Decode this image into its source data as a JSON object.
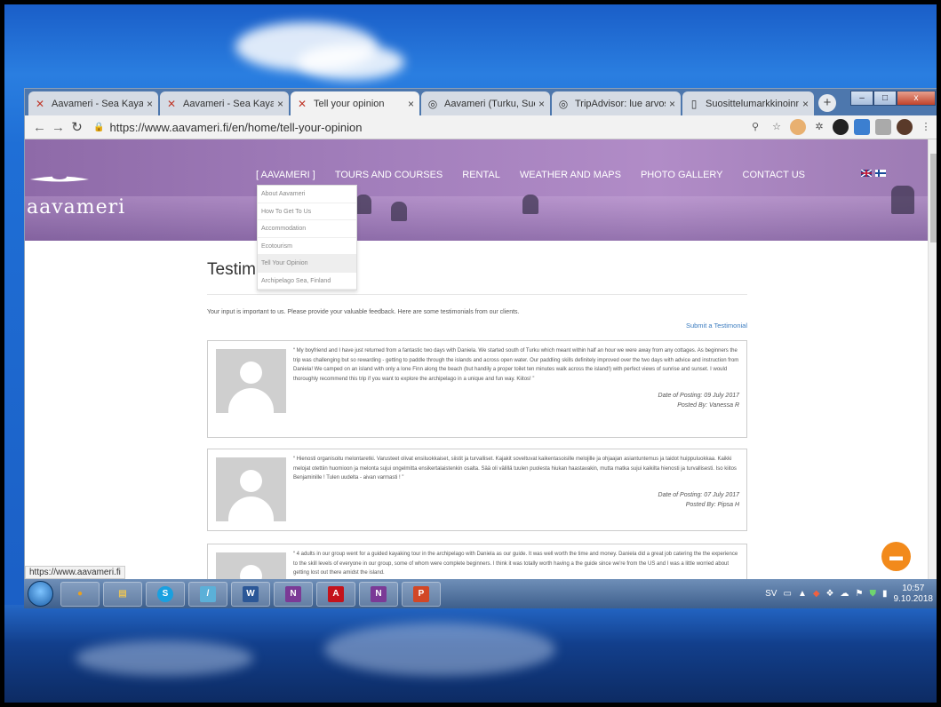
{
  "browser": {
    "tabs": [
      {
        "label": "Aavameri - Sea Kayaking",
        "icon": "aavameri-favicon",
        "active": false
      },
      {
        "label": "Aavameri - Sea Kayaking",
        "icon": "aavameri-favicon",
        "active": false
      },
      {
        "label": "Tell your opinion",
        "icon": "aavameri-favicon",
        "active": true
      },
      {
        "label": "Aavameri (Turku, Suomi)",
        "icon": "tripadvisor-favicon",
        "active": false
      },
      {
        "label": "TripAdvisor: lue arvostel",
        "icon": "tripadvisor-favicon",
        "active": false
      },
      {
        "label": "Suosittelumarkkinoinnin",
        "icon": "document-favicon",
        "active": false
      }
    ],
    "new_tab": "+",
    "close_glyph": "×",
    "window_buttons": {
      "minimize": "–",
      "maximize": "□",
      "close": "x"
    },
    "url": "https://www.aavameri.fi/en/home/tell-your-opinion",
    "status_url": "https://www.aavameri.fi"
  },
  "site": {
    "logo": "aavameri",
    "nav": [
      "[ Aavameri ]",
      "Tours and Courses",
      "Rental",
      "Weather and maps",
      "Photo Gallery",
      "Contact Us"
    ],
    "dropdown": [
      "About Aavameri",
      "How To Get To Us",
      "Accommodation",
      "Ecotourism",
      "Tell Your Opinion",
      "Archipelago Sea, Finland"
    ],
    "dropdown_highlight_index": 4
  },
  "main": {
    "title": "Testim",
    "intro": "Your input is important to us. Please provide your valuable feedback. Here are some testimonials from our clients.",
    "submit_link": "Submit a Testimonial",
    "testimonials": [
      {
        "text": "“ My boyfriend and I have just returned from a fantastic two days with Daniela. We started south of Turku which meant within half an hour we were away from any cottages. As beginners the trip was challenging but so rewarding - getting to paddle through the islands and across open water. Our paddling skills definitely improved over the two days with advice and instruction from Daniela! We camped on an island with only a lone Finn along the beach (but handily a proper toilet ten minutes walk across the island!) with perfect views of sunrise and sunset. I would thoroughly recommend this trip if you want to explore the archipelago in a unique and fun way. Kiitos! ”",
        "date": "Date of Posting: 09 July 2017",
        "author": "Posted By: Vanessa R"
      },
      {
        "text": "“ Hienosti organisoitu melontaretki. Varusteet olivat ensiluokkaiset, siistit ja turvalliset. Kajakit soveltuvat kaikentasoisille melojille ja ohjaajan asiantuntemus ja taidot huippuluokkaa. Kaikki melojat otettiin huomioon ja melonta sujui ongelmitta ensikertalaistenkin osalta. Sää oli välillä tuulen puolesta hiukan haastavakin, mutta matka sujui kaikilta hienosti ja turvallisesti. Iso kiitos Benjaminille ! Tulen uudelta - aivan varmasti ! ”",
        "date": "Date of Posting: 07 July 2017",
        "author": "Posted By: Pipsa H"
      },
      {
        "text": "“ 4 adults in our group went for a guided kayaking tour in the archipelago with Daniela as our guide. It was well worth the time and money. Daniela did a great job catering the the experience to the skill levels of everyone in our group, some of whom were complete beginners. I think it was totally worth having a the guide since we're from the US and I was a little worried about getting lost out there amidst the island.",
        "date": "",
        "author": ""
      }
    ]
  },
  "taskbar": {
    "apps": [
      {
        "name": "chrome",
        "glyph": "●",
        "color": "#e8a020"
      },
      {
        "name": "explorer",
        "glyph": "▤",
        "color": "#e6c25a"
      },
      {
        "name": "skype",
        "glyph": "S",
        "color": "#1aa0e0"
      },
      {
        "name": "notes",
        "glyph": "/",
        "color": "#5bb0d8"
      },
      {
        "name": "word",
        "glyph": "W",
        "color": "#2b5797"
      },
      {
        "name": "onenote-2",
        "glyph": "N",
        "color": "#7b3a96"
      },
      {
        "name": "acrobat",
        "glyph": "A",
        "color": "#c4121b"
      },
      {
        "name": "onenote",
        "glyph": "N",
        "color": "#7b3a96"
      },
      {
        "name": "powerpoint",
        "glyph": "P",
        "color": "#d24726"
      }
    ],
    "language": "SV",
    "time": "10:57",
    "date": "9.10.2018"
  },
  "colors": {
    "header_purple": "#a37fbc",
    "link_blue": "#3a7bbf",
    "chat_orange": "#f28a1b"
  }
}
